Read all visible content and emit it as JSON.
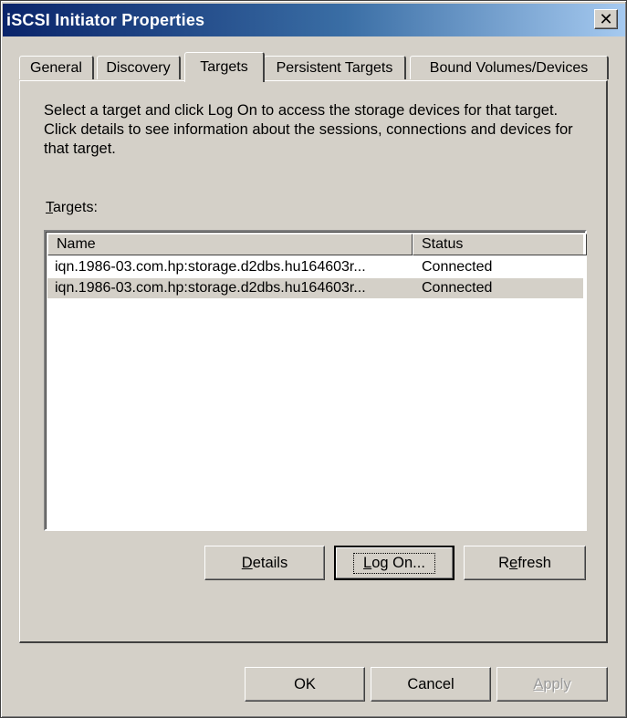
{
  "window": {
    "title": "iSCSI Initiator Properties",
    "close_glyph": "✕"
  },
  "tabs": [
    {
      "label": "General"
    },
    {
      "label": "Discovery"
    },
    {
      "label": "Targets",
      "active": true
    },
    {
      "label": "Persistent Targets"
    },
    {
      "label": "Bound Volumes/Devices"
    }
  ],
  "targets_tab": {
    "description": "Select a target and click Log On to access the storage devices for that target. Click details to see information about the sessions, connections and devices for that target.",
    "list_label_mnemonic": "T",
    "list_label_rest": "argets:",
    "columns": [
      "Name",
      "Status"
    ],
    "rows": [
      {
        "name": "iqn.1986-03.com.hp:storage.d2dbs.hu164603r...",
        "status": "Connected"
      },
      {
        "name": "iqn.1986-03.com.hp:storage.d2dbs.hu164603r...",
        "status": "Connected"
      }
    ],
    "buttons": {
      "details_mnemonic": "D",
      "details_rest": "etails",
      "logon_mnemonic": "L",
      "logon_rest": "og On...",
      "refresh_pre": "R",
      "refresh_mnemonic": "e",
      "refresh_rest": "fresh"
    }
  },
  "footer": {
    "ok": "OK",
    "cancel": "Cancel",
    "apply_mnemonic": "A",
    "apply_rest": "pply"
  }
}
